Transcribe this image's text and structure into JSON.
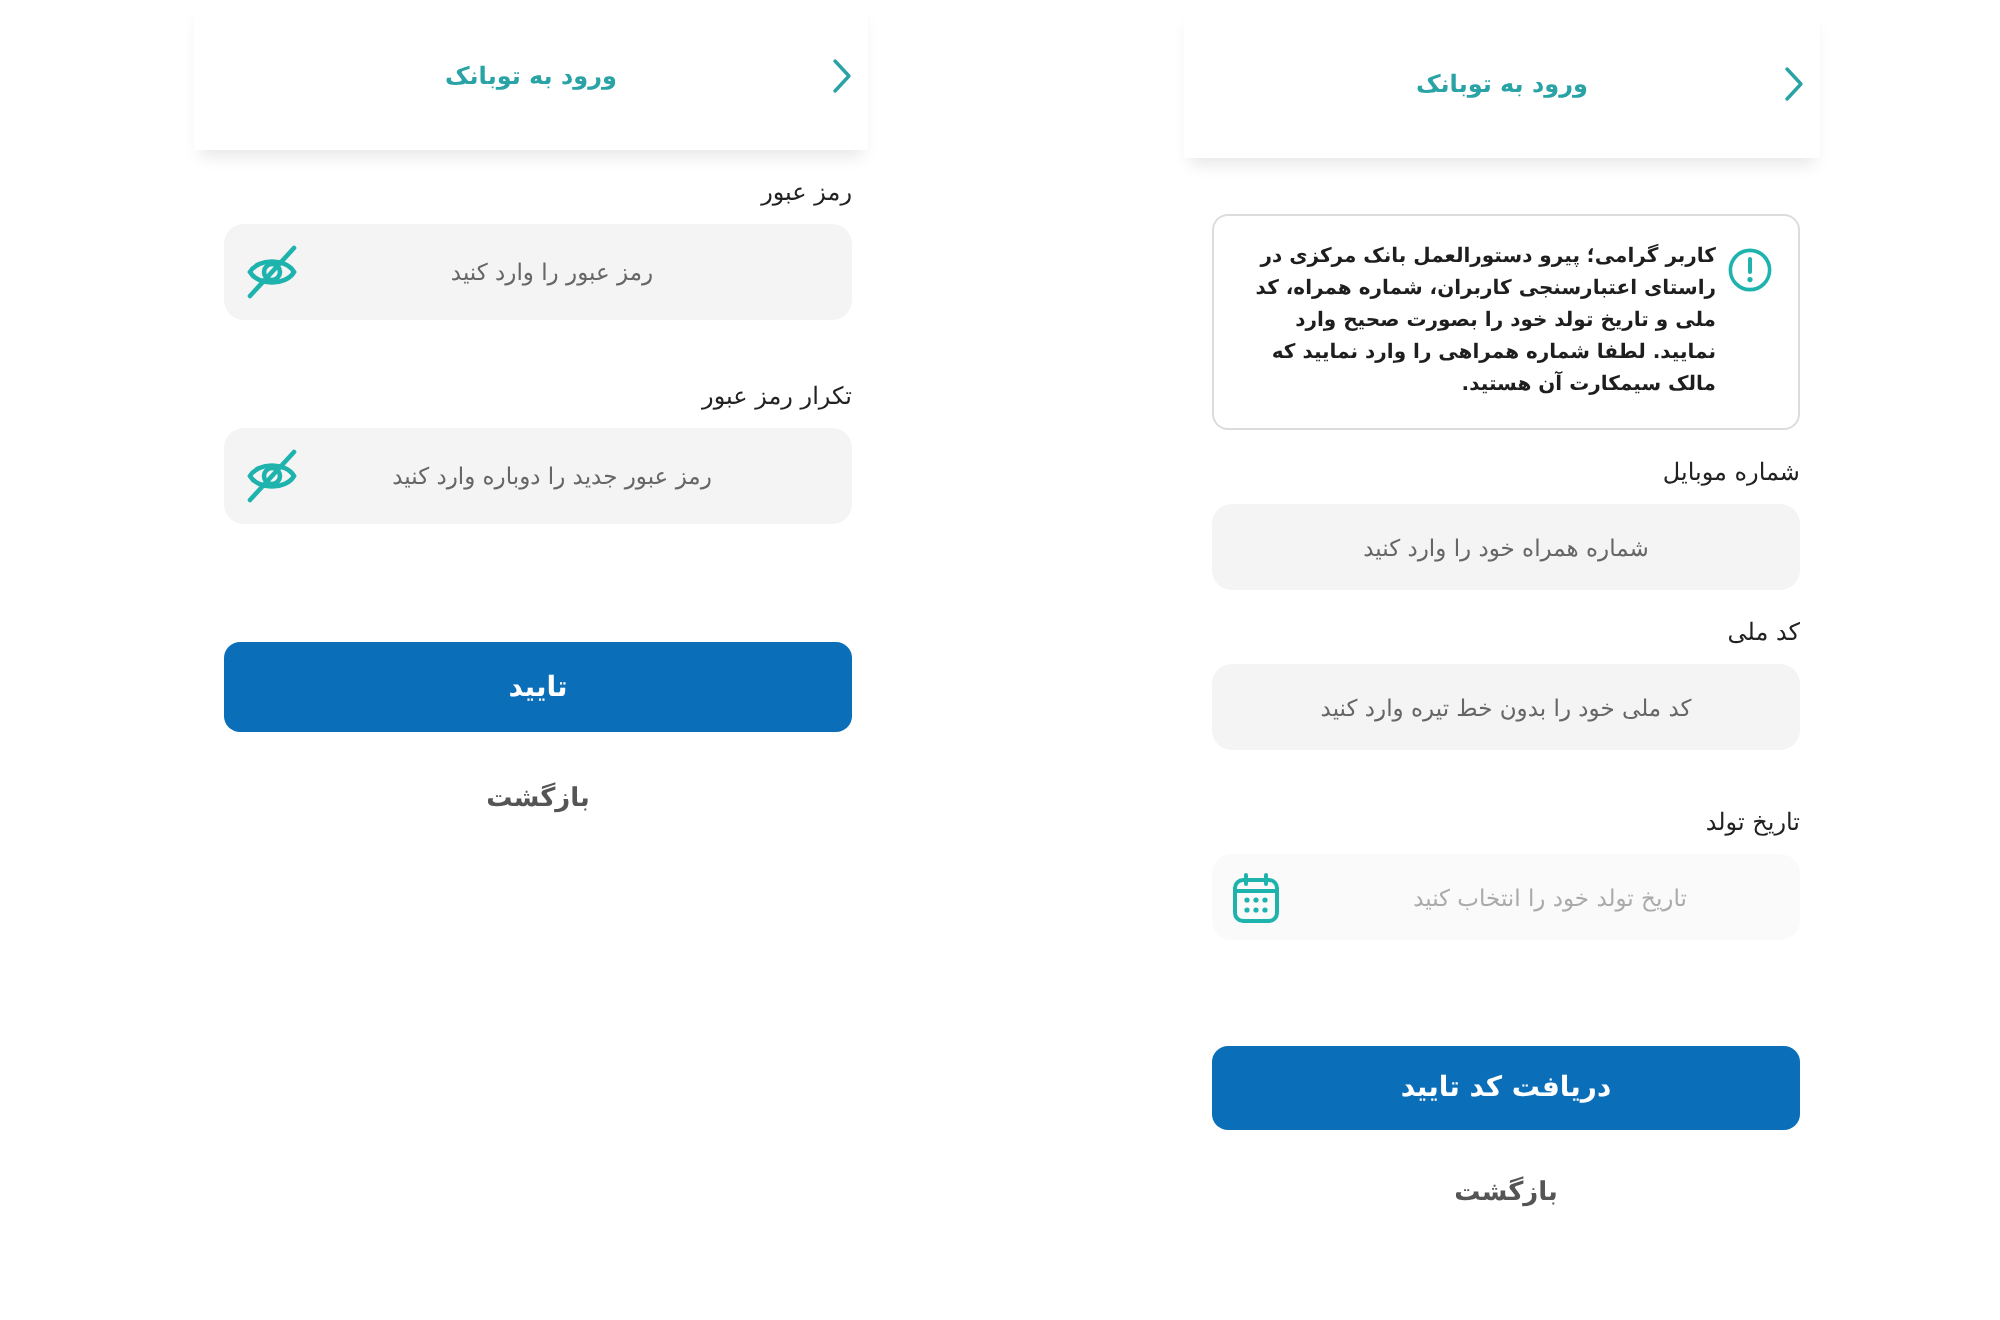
{
  "screens": [
    {
      "header": {
        "title": "ورود به توبانک"
      },
      "notice": "کاربر گرامی؛ پیرو دستورالعمل بانک مرکزی در راستای اعتبارسنجی کاربران، شماره همراه، کد ملی و تاریخ تولد خود را بصورت صحیح وارد نمایید. لطفا شماره همراهی را وارد نمایید که مالک سیمکارت آن هستید.",
      "fields": [
        {
          "kind": "text",
          "label": "شماره موبایل",
          "placeholder": "شماره همراه خود را وارد کنید"
        },
        {
          "kind": "text",
          "label": "کد ملی",
          "placeholder": "کد ملی خود را بدون خط تیره وارد کنید"
        },
        {
          "kind": "date",
          "label": "تاریخ تولد",
          "placeholder": "تاریخ تولد خود را انتخاب کنید"
        }
      ],
      "submit_button": "دریافت کد تایید",
      "back_link": "بازگشت"
    },
    {
      "header": {
        "title": "ورود به توبانک"
      },
      "fields": [
        {
          "kind": "password",
          "label": "رمز عبور",
          "placeholder": "رمز عبور را وارد کنید"
        },
        {
          "kind": "password",
          "label": "تکرار رمز عبور",
          "placeholder": "رمز عبور جدید را دوباره وارد کنید"
        }
      ],
      "submit_button": "تایید",
      "back_link": "بازگشت"
    }
  ]
}
